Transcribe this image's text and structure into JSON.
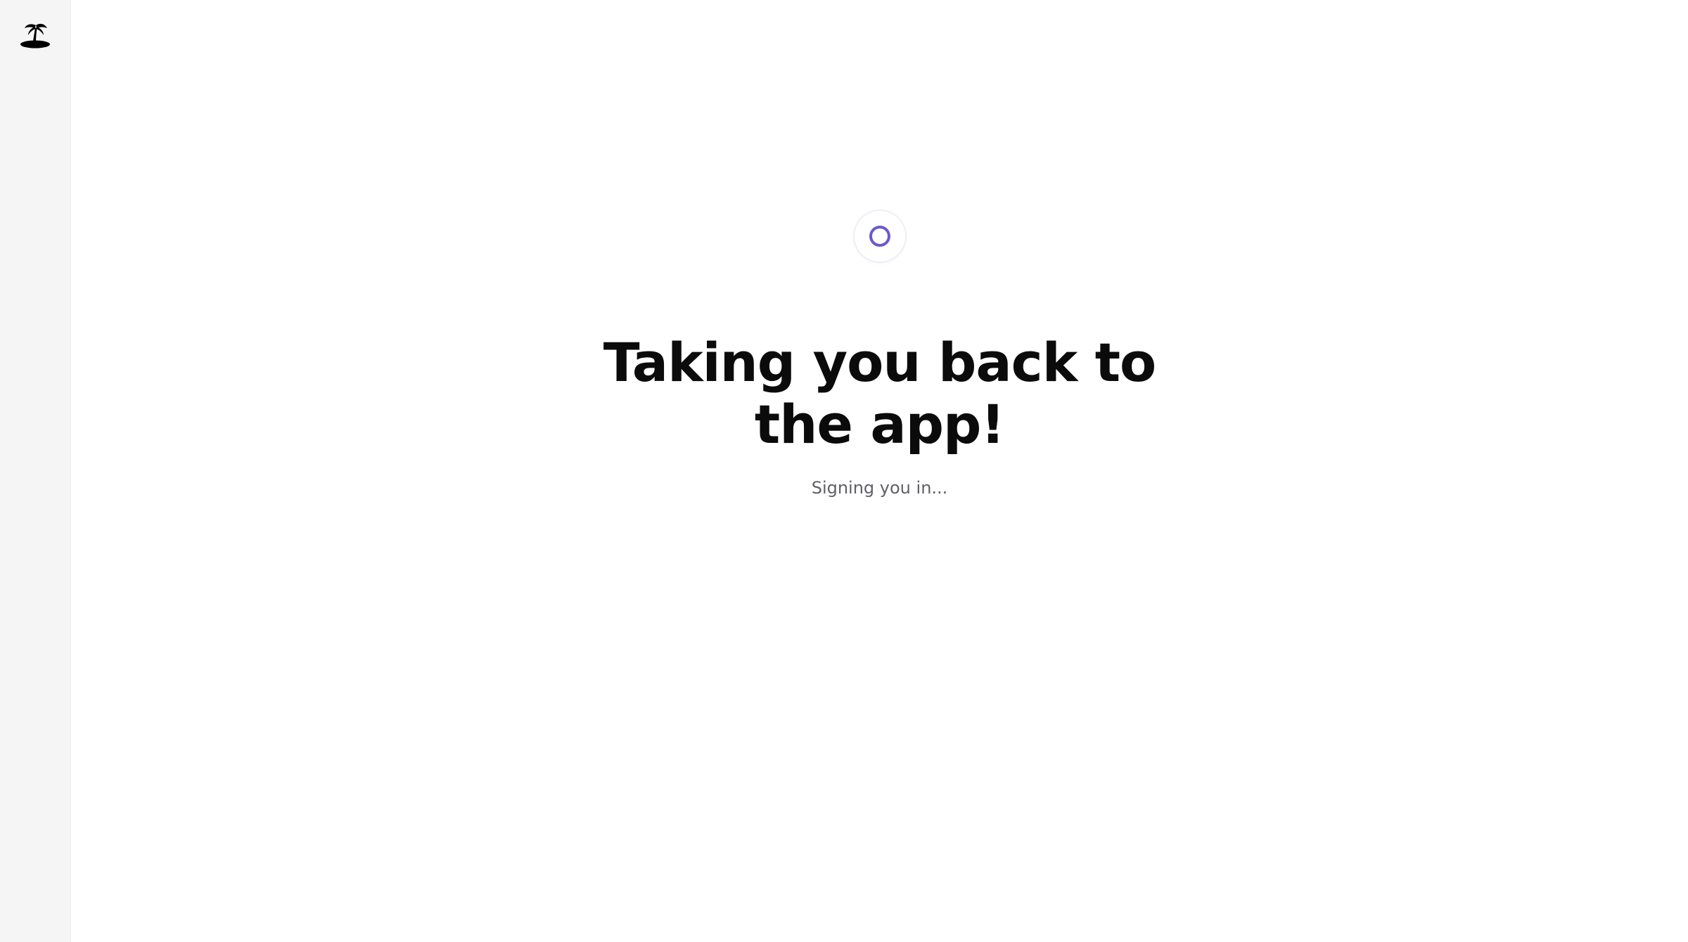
{
  "sidebar": {
    "logo_icon": "palm-island-icon"
  },
  "main": {
    "spinner_icon": "loading-spinner-icon",
    "accent_color": "#6a5acd",
    "headline": "Taking you back to the app!",
    "subtext": "Signing you in..."
  }
}
